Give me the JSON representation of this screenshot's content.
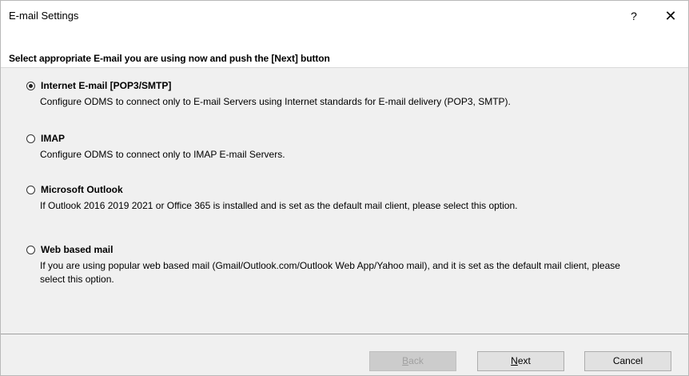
{
  "window": {
    "title": "E-mail Settings",
    "help_label": "?",
    "close_label": "✕"
  },
  "instruction": "Select appropriate E-mail you are using now and push the [Next] button",
  "options": [
    {
      "label": "Internet E-mail [POP3/SMTP]",
      "description": "Configure ODMS to connect only to E-mail Servers using Internet standards for E-mail delivery (POP3, SMTP).",
      "selected": true
    },
    {
      "label": "IMAP",
      "description": "Configure ODMS to connect only to IMAP E-mail Servers.",
      "selected": false
    },
    {
      "label": "Microsoft Outlook",
      "description": "If Outlook 2016 2019 2021 or Office 365 is installed and is set as the default mail client, please select this option.",
      "selected": false
    },
    {
      "label": "Web based mail",
      "description": "If you are using popular web based mail (Gmail/Outlook.com/Outlook Web App/Yahoo mail), and it is set as the default mail client, please select this option.",
      "selected": false
    }
  ],
  "buttons": {
    "back_mnemonic": "B",
    "back_rest": "ack",
    "back_enabled": false,
    "next_mnemonic": "N",
    "next_rest": "ext",
    "cancel_label": "Cancel"
  },
  "colors": {
    "dialog_bg": "#f0f0f0",
    "header_bg": "#ffffff",
    "button_bg": "#e1e1e1",
    "disabled_text": "#a0a0a0"
  }
}
